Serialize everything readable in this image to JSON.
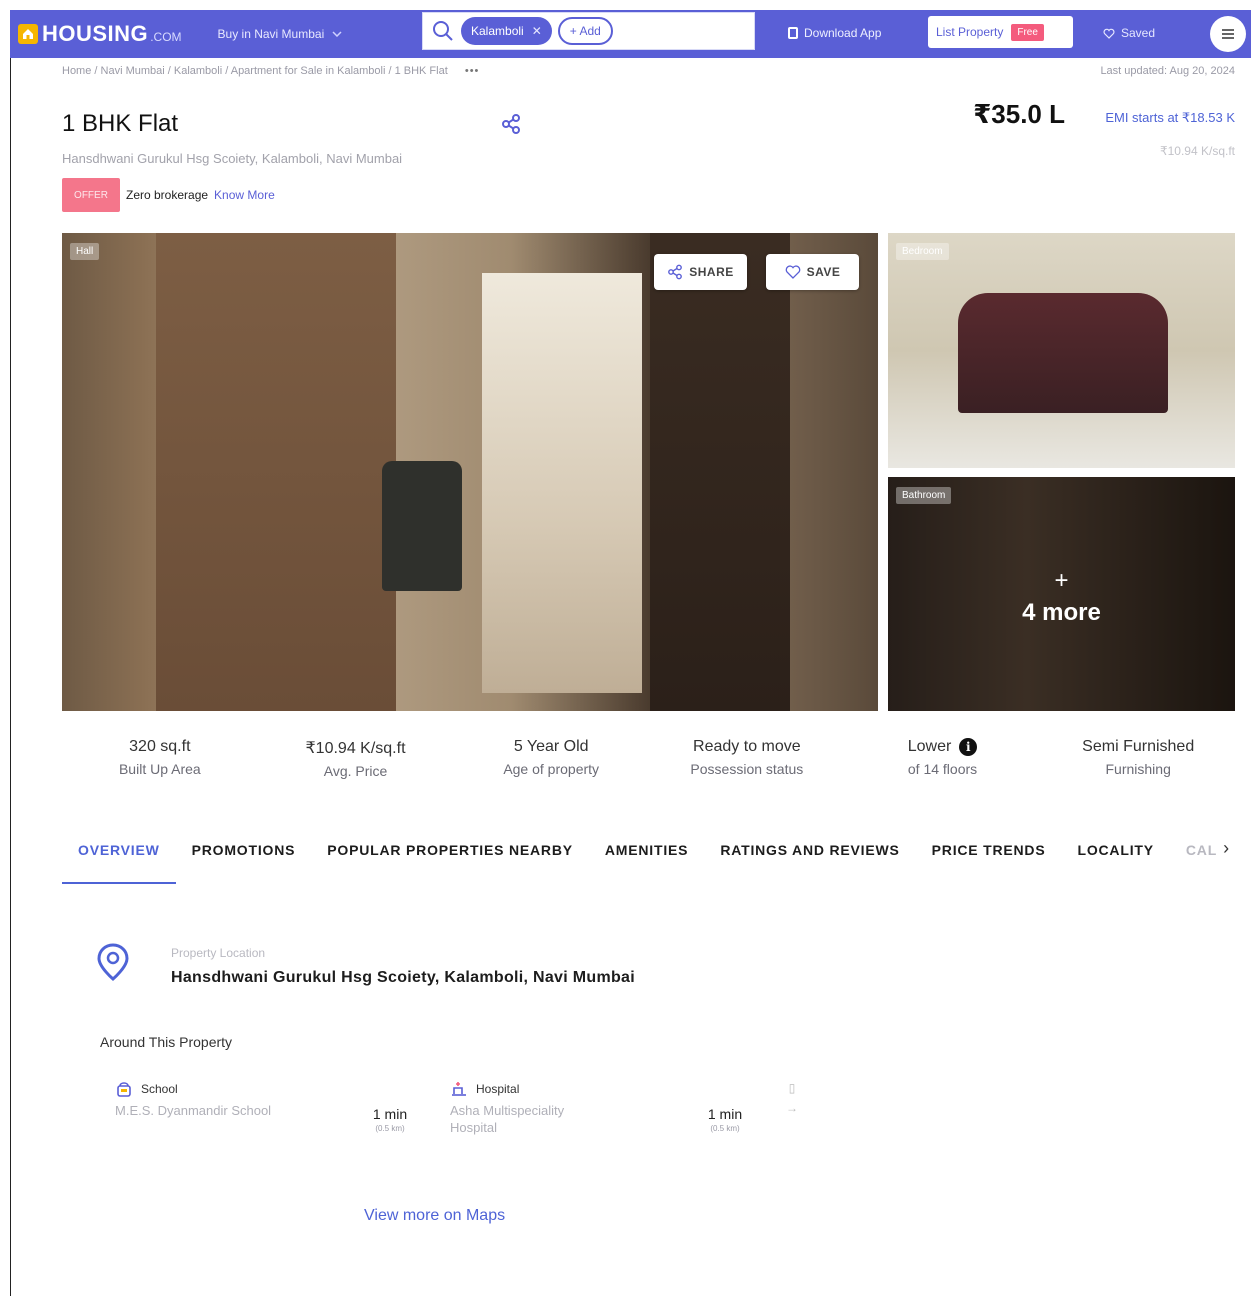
{
  "header": {
    "logo_text": "HOUSING",
    "logo_suffix": ".COM",
    "buy_select": "Buy in Navi Mumbai",
    "search_chip": "Kalamboli",
    "add_chip": "+ Add",
    "download_app": "Download App",
    "list_property": "List Property",
    "free_badge": "Free",
    "saved": "Saved"
  },
  "breadcrumb": {
    "path": "Home / Navi Mumbai / Kalamboli / Apartment for Sale in Kalamboli / 1 BHK Flat",
    "more": "•••",
    "last_updated": "Last updated: Aug 20, 2024"
  },
  "listing": {
    "title": "1 BHK Flat",
    "address": "Hansdhwani Gurukul Hsg Scoiety, Kalamboli, Navi Mumbai",
    "offer_badge": "OFFER",
    "offer_text": "Zero brokerage",
    "know_more": "Know More",
    "price": "₹35.0 L",
    "emi": "EMI starts at ₹18.53 K",
    "per_sqft": "₹10.94 K/sq.ft"
  },
  "gallery": {
    "main_label": "Hall",
    "bedroom_label": "Bedroom",
    "bathroom_label": "Bathroom",
    "share_label": "SHARE",
    "save_label": "SAVE",
    "more_plus": "+",
    "more_text": "4 more"
  },
  "stats": [
    {
      "value": "320 sq.ft",
      "label": "Built Up Area"
    },
    {
      "value": "₹10.94 K/sq.ft",
      "label": "Avg. Price"
    },
    {
      "value": "5 Year Old",
      "label": "Age of property"
    },
    {
      "value": "Ready to move",
      "label": "Possession status"
    },
    {
      "value": "Lower",
      "label": "of 14 floors"
    },
    {
      "value": "Semi Furnished",
      "label": "Furnishing"
    }
  ],
  "tabs": [
    "OVERVIEW",
    "PROMOTIONS",
    "POPULAR PROPERTIES NEARBY",
    "AMENITIES",
    "RATINGS AND REVIEWS",
    "PRICE TRENDS",
    "LOCALITY",
    "CAL"
  ],
  "location": {
    "label": "Property Location",
    "address": "Hansdhwani Gurukul Hsg Scoiety, Kalamboli, Navi Mumbai",
    "around_title": "Around This Property",
    "pois": [
      {
        "category": "School",
        "name": "M.E.S. Dyanmandir School",
        "time": "1 min",
        "distance": "(0.5 km)"
      },
      {
        "category": "Hospital",
        "name": "Asha Multispeciality Hospital",
        "time": "1 min",
        "distance": "(0.5 km)"
      }
    ],
    "view_maps": "View more on Maps"
  },
  "colors": {
    "brand": "#5a5fd6",
    "link": "#4e63d6",
    "offer": "#f4768b"
  }
}
